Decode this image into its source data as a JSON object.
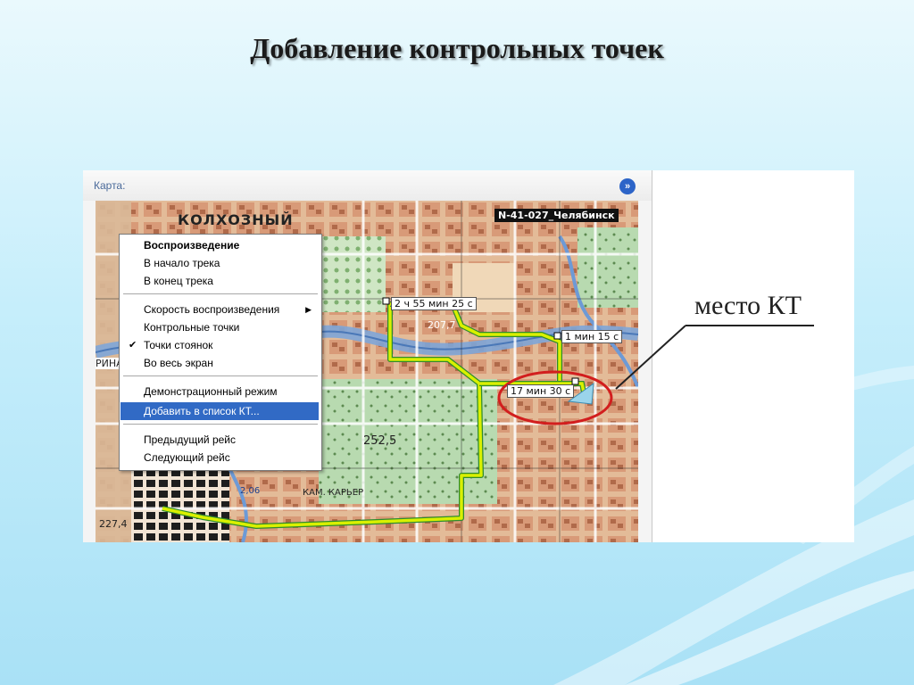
{
  "slide": {
    "title": "Добавление контрольных точек"
  },
  "panel": {
    "title": "Карта:",
    "collapse_icon": "double-chevron-right-icon"
  },
  "map": {
    "sheet_label": "N-41-027_Челябинск",
    "labels": {
      "kolkhozny": "КОЛХОЗНЫЙ",
      "height_252": "252,5",
      "kam_karer": "КАМ. КАРЬЕР",
      "height_227": "227,4",
      "height_207": "207,7",
      "rina": "РИНА",
      "n206": "2,06"
    },
    "track_labels": {
      "t1": "2 ч 55 мин 25 с",
      "t2": "1 мин 15 с",
      "t3": "17 мин 30 с"
    },
    "colors": {
      "track": "#d9f000",
      "track_edge": "#2e8b2e",
      "highlight_ring": "#d21e1e",
      "arrow": "#9ad4ea"
    }
  },
  "context_menu": {
    "items": [
      {
        "label": "Воспроизведение",
        "bold": true
      },
      {
        "label": "В начало трека"
      },
      {
        "label": "В конец трека"
      },
      {
        "label": "Скорость воспроизведения",
        "submenu": true
      },
      {
        "label": "Контрольные точки"
      },
      {
        "label": "Точки стоянок",
        "checked": true
      },
      {
        "label": "Во весь экран"
      },
      {
        "label": "Демонстрационный режим"
      },
      {
        "label": "Добавить в список КТ...",
        "highlighted": true
      },
      {
        "label": "Предыдущий рейс"
      },
      {
        "label": "Следующий рейс"
      }
    ],
    "check_mark": "✔",
    "submenu_arrow": "▶"
  },
  "callout": {
    "text": "место КТ"
  }
}
